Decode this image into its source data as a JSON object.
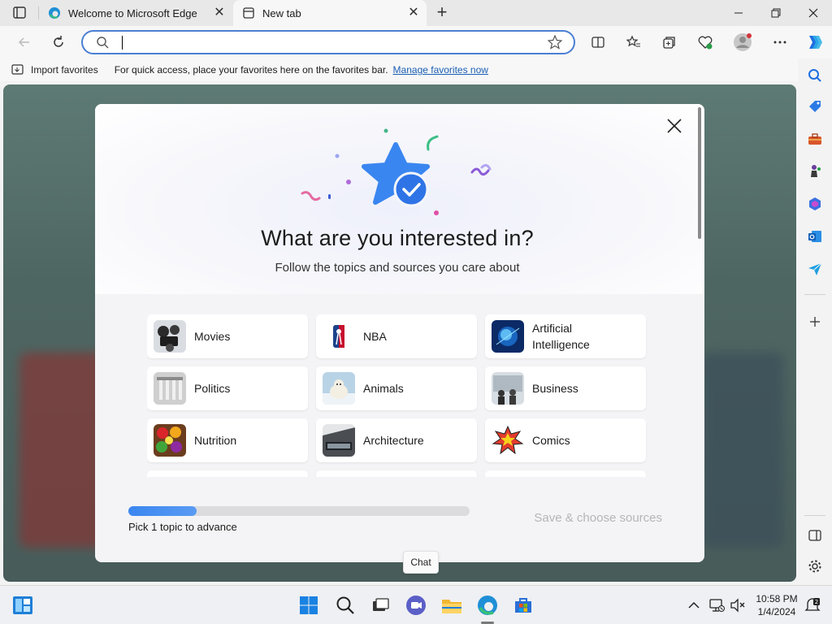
{
  "browser": {
    "tabs": [
      {
        "title": "Welcome to Microsoft Edge",
        "icon": "edge-icon"
      },
      {
        "title": "New tab",
        "icon": "newtab-icon"
      }
    ],
    "address": {
      "value": "",
      "placeholder": ""
    }
  },
  "favorites_bar": {
    "import_label": "Import favorites",
    "message": "For quick access, place your favorites here on the favorites bar.",
    "manage_link": "Manage favorites now"
  },
  "modal": {
    "title": "What are you interested in?",
    "subtitle": "Follow the topics and sources you care about",
    "topics": [
      {
        "label": "Movies"
      },
      {
        "label": "NBA"
      },
      {
        "label": "Artificial Intelligence"
      },
      {
        "label": "Politics"
      },
      {
        "label": "Animals"
      },
      {
        "label": "Business"
      },
      {
        "label": "Nutrition"
      },
      {
        "label": "Architecture"
      },
      {
        "label": "Comics"
      }
    ],
    "progress_fraction": 0.2,
    "pick_text": "Pick 1 topic to advance",
    "save_label": "Save & choose sources"
  },
  "tooltip": {
    "text": "Chat"
  },
  "taskbar": {
    "time": "10:58 PM",
    "date": "1/4/2024"
  },
  "colors": {
    "accent": "#3a86f0",
    "link": "#1a5fb4",
    "address_border": "#4a7fd4"
  }
}
